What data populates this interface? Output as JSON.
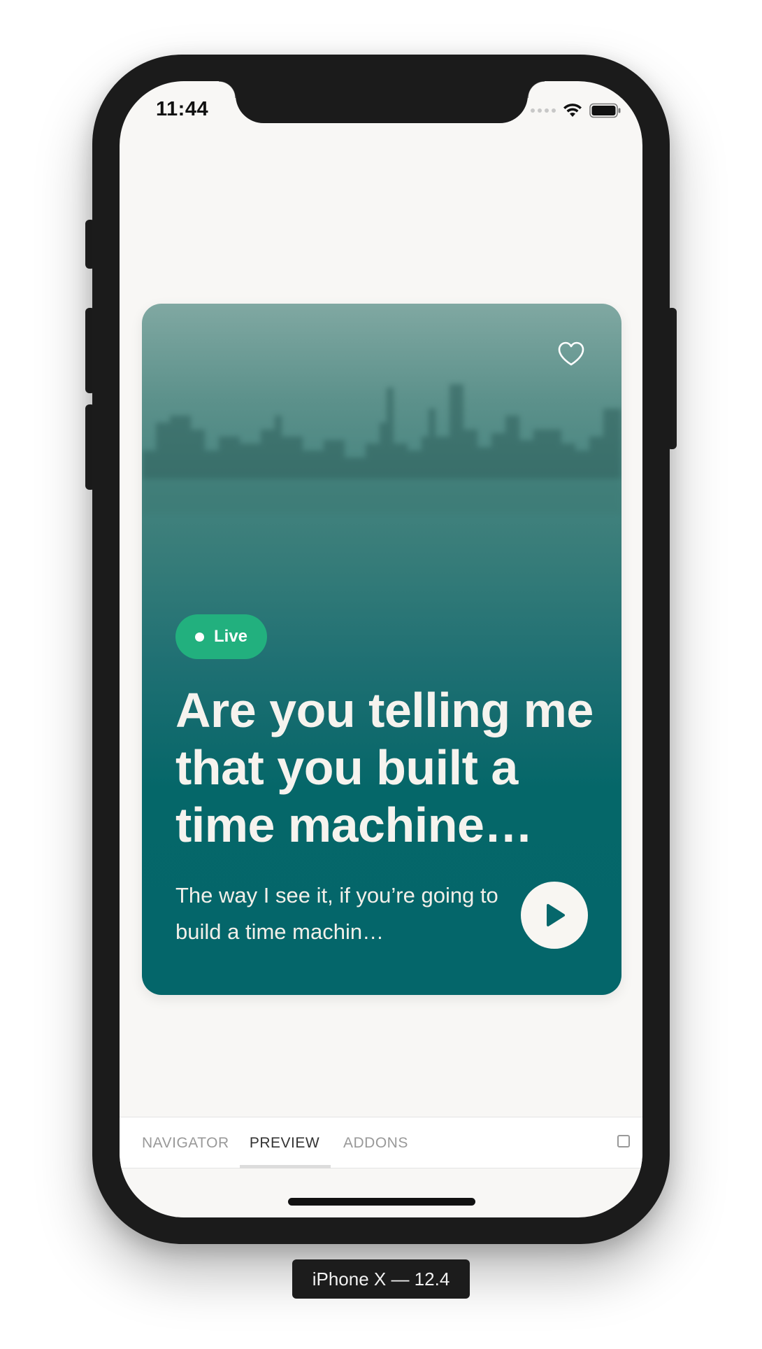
{
  "status_bar": {
    "time": "11:44"
  },
  "card": {
    "badge_label": "Live",
    "title": "Are you telling me that you built a time machine…",
    "description": "The way I see it, if you’re going to build a time machin…",
    "gradient_top_color": "#80a8a2",
    "gradient_bottom_color": "#04666a",
    "badge_color": "#22b07e",
    "favorite_icon": "heart-outline-icon",
    "play_icon": "play-icon"
  },
  "panel_tabs": {
    "navigator": "NAVIGATOR",
    "preview": "PREVIEW",
    "addons": "ADDONS",
    "active": "PREVIEW"
  },
  "device_label": "iPhone X — 12.4"
}
